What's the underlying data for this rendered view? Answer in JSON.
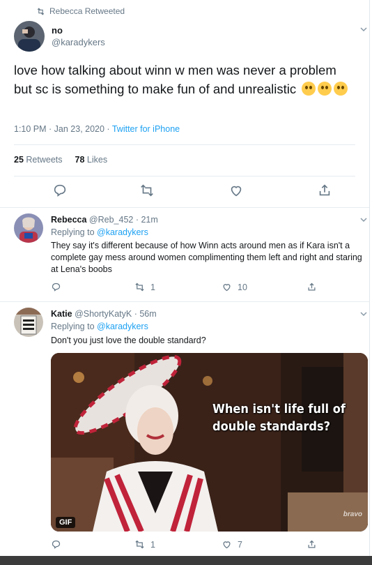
{
  "retweet_header": {
    "text": "Rebecca Retweeted"
  },
  "main_tweet": {
    "author_name": "no",
    "author_handle": "@karadykers",
    "text": "love how talking about winn w men was never a problem but sc is something to make fun of and unrealistic",
    "emojis": [
      "flushed-face-icon",
      "face-with-monocle-icon",
      "face-with-raised-eyebrow-icon"
    ],
    "time": "1:10 PM · Jan 23, 2020",
    "source_sep": " · ",
    "source": "Twitter for iPhone",
    "retweets_count": "25",
    "retweets_label": "Retweets",
    "likes_count": "78",
    "likes_label": "Likes"
  },
  "replies": [
    {
      "name": "Rebecca",
      "handle": "@Reb_452",
      "time": " · 21m",
      "replying_label": "Replying to ",
      "replying_to": "@karadykers",
      "text": "They say it's different because of how Winn acts around men as if Kara isn't a complete gay mess around women complimenting them left and right and staring at Lena's boobs",
      "retweets": "1",
      "likes": "10"
    },
    {
      "name": "Katie",
      "handle": "@ShortyKatyK",
      "time": " · 56m",
      "replying_label": "Replying to ",
      "replying_to": "@karadykers",
      "text": "Don't you just love the double standard?",
      "gif_caption_line1": "When isn't life full of",
      "gif_caption_line2": "double standards?",
      "gif_badge": "GIF",
      "gif_watermark": "bravo",
      "retweets": "1",
      "likes": "7"
    }
  ],
  "colors": {
    "accent": "#1da1f2",
    "muted": "#657786",
    "text": "#14171a",
    "border": "#e6ecf0"
  }
}
